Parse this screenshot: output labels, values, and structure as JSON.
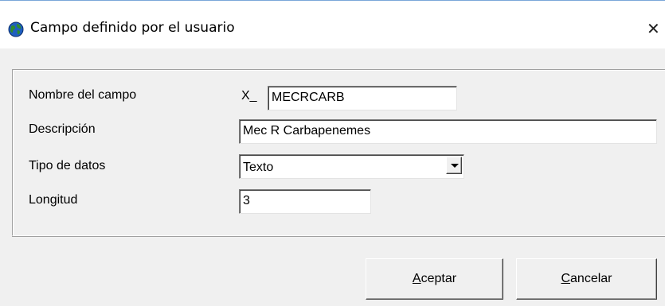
{
  "window": {
    "title": "Campo definido por el usuario",
    "close_glyph": "✕"
  },
  "form": {
    "field_name": {
      "label": "Nombre del campo",
      "prefix": "X_",
      "value": "MECRCARB"
    },
    "description": {
      "label": "Descripción",
      "value": "Mec R Carbapenemes"
    },
    "data_type": {
      "label": "Tipo de datos",
      "value": "Texto"
    },
    "length": {
      "label": "Longitud",
      "value": "3"
    }
  },
  "buttons": {
    "accept": {
      "accel": "A",
      "rest": "ceptar"
    },
    "cancel": {
      "accel": "C",
      "rest": "ancelar"
    }
  },
  "icons": {
    "app": "globe-icon",
    "dropdown": "chevron-down-icon"
  },
  "colors": {
    "window_bg": "#f0f0f0",
    "titlebar_bg": "#ffffff",
    "field_bg": "#ffffff",
    "globe_green": "#2e8b2e",
    "globe_blue": "#1f5fbf"
  }
}
